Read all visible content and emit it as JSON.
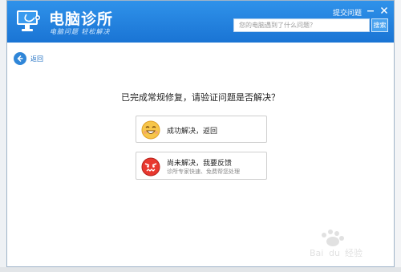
{
  "app": {
    "title": "电脑诊所",
    "slogan": "电脑问题 轻松解决",
    "feedback_label": "提交问题"
  },
  "search": {
    "placeholder": "您的电脑遇到了什么问题？",
    "button_label": "搜索"
  },
  "nav": {
    "back_label": "返回"
  },
  "main": {
    "question": "已完成常规修复，请验证问题是否解决？",
    "options": [
      {
        "title": "成功解决，返回",
        "icon": "happy-face-icon"
      },
      {
        "title": "尚未解决，我要反馈",
        "subtitle": "诊所专家快速、免费帮您处理",
        "icon": "angry-face-icon"
      }
    ]
  },
  "colors": {
    "header": "#1f7fdc",
    "accent": "#2f86d8"
  }
}
